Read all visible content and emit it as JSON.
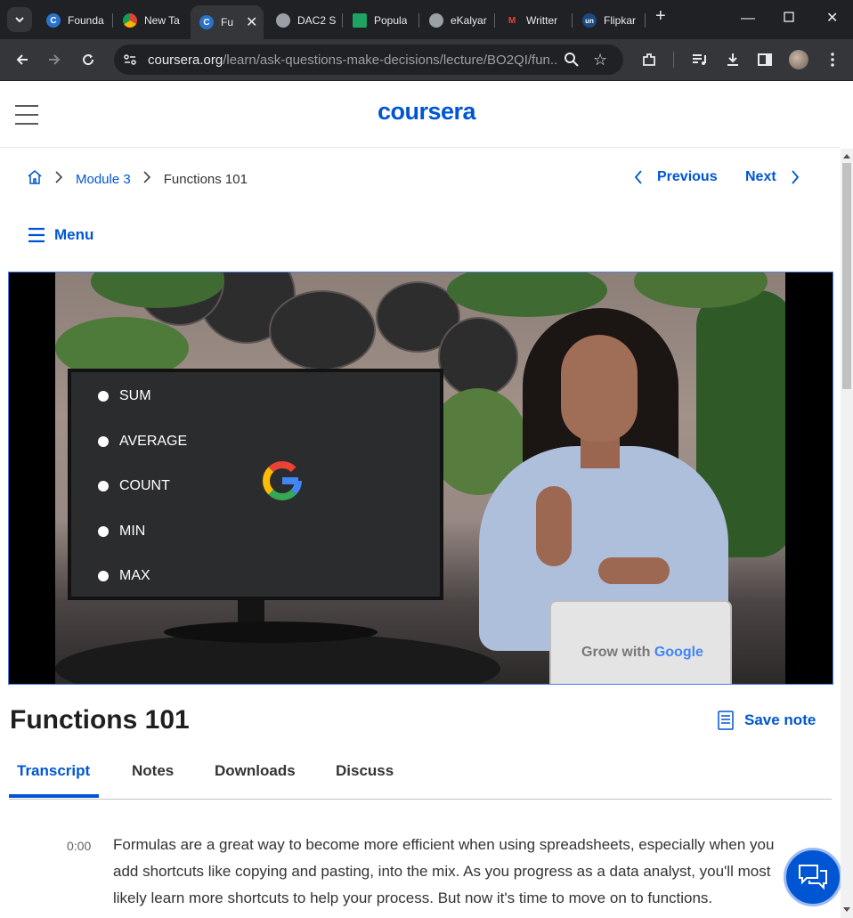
{
  "browser": {
    "tabs": [
      {
        "title": "Founda",
        "favicon": "coursera-icon",
        "fav_color": "#2a73cc",
        "fav_glyph": "C"
      },
      {
        "title": "New Ta",
        "favicon": "chrome-icon",
        "fav_color": "#ffffff",
        "fav_glyph": ""
      },
      {
        "title": "Fu",
        "favicon": "coursera-icon",
        "fav_color": "#2a73cc",
        "fav_glyph": "C"
      },
      {
        "title": "DAC2 S",
        "favicon": "globe-icon",
        "fav_color": "#9aa0a6",
        "fav_glyph": ""
      },
      {
        "title": "Popula",
        "favicon": "sheets-icon",
        "fav_color": "#1ea362",
        "fav_glyph": ""
      },
      {
        "title": "eKalyar",
        "favicon": "globe-icon",
        "fav_color": "#9aa0a6",
        "fav_glyph": ""
      },
      {
        "title": "Writter",
        "favicon": "gmail-icon",
        "fav_color": "#ea4335",
        "fav_glyph": "M"
      },
      {
        "title": "Flipkar",
        "favicon": "unstop-icon",
        "fav_color": "#1c4980",
        "fav_glyph": "un"
      }
    ],
    "url_host": "coursera.org",
    "url_path": "/learn/ask-questions-make-decisions/lecture/BO2QI/fun..."
  },
  "header": {
    "logo": "coursera"
  },
  "breadcrumb": {
    "module": "Module 3",
    "current": "Functions 101"
  },
  "nav": {
    "previous": "Previous",
    "next": "Next"
  },
  "menu_label": "Menu",
  "video": {
    "items": [
      "SUM",
      "AVERAGE",
      "COUNT",
      "MIN",
      "MAX"
    ],
    "laptop_text_1": "Grow with ",
    "laptop_text_2": "Google"
  },
  "lecture": {
    "title": "Functions 101",
    "save_note": "Save note"
  },
  "tabs": [
    "Transcript",
    "Notes",
    "Downloads",
    "Discuss"
  ],
  "transcript": {
    "time": "0:00",
    "text": "Formulas are a great way to become more efficient when using spreadsheets, especially when you add shortcuts like copying and pasting, into the mix. As you progress as a data analyst, you'll most likely learn more shortcuts to help your process. But now it's time to move on to functions."
  },
  "colors": {
    "accent": "#0056d2",
    "chrome_dark": "#202124",
    "chrome_mid": "#35363a"
  }
}
